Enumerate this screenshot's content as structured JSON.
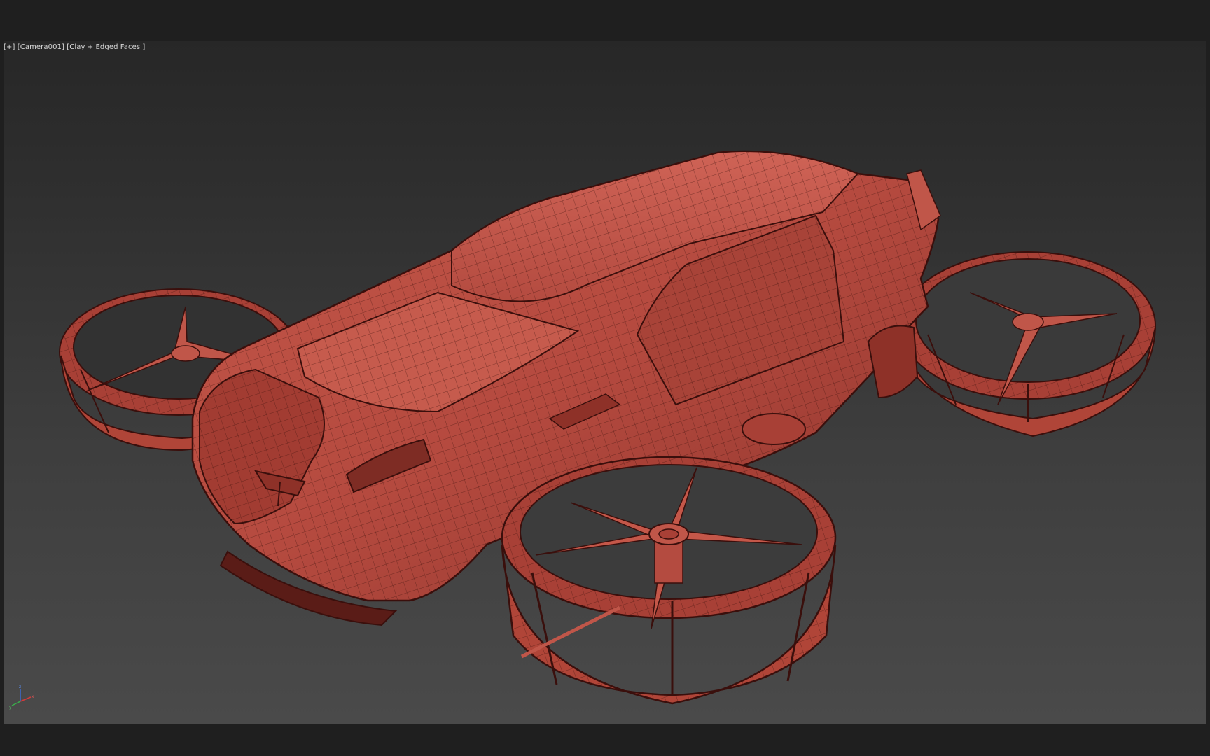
{
  "viewport": {
    "label": "[+] [Camera001] [Clay + Edged Faces ]"
  },
  "scene": {
    "object": "flying-car-model",
    "shading_color": "#b84a40",
    "edge_color": "#3a0f0c",
    "highlight_color": "#cf6356"
  },
  "gizmo": {
    "axis_x": "x",
    "axis_y": "y",
    "axis_z": "z",
    "color_x": "#d23a3a",
    "color_y": "#3ab04a",
    "color_z": "#3a6ad2"
  }
}
